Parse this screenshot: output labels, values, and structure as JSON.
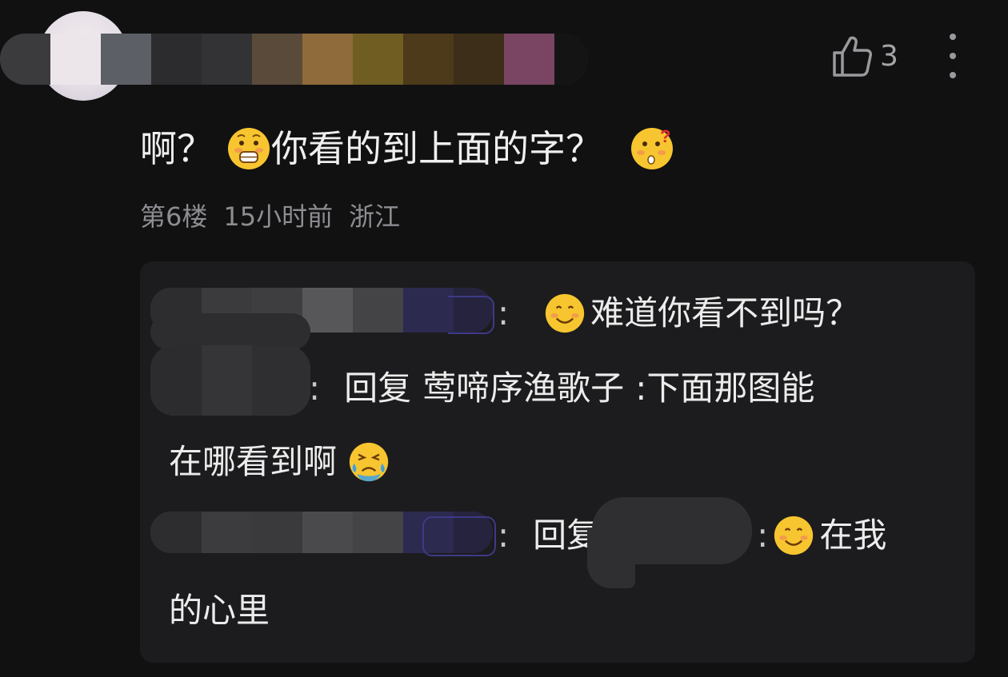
{
  "comment": {
    "like_count": "3",
    "text_part1": "啊？",
    "text_part2": "你看的到上面的字？",
    "meta": {
      "floor": "第6楼",
      "time": "15小时前",
      "location": "浙江"
    }
  },
  "replies": [
    {
      "colon": ":",
      "text": "难道你看不到吗？"
    },
    {
      "colon": ":",
      "reply_word": "回复",
      "target": "莺啼序渔歌子",
      "text_line1": ":下面那图能",
      "text_line2": "在哪看到啊"
    },
    {
      "colon": ":",
      "reply_word": "回复",
      "separator": ":",
      "text_line1": "在我",
      "text_line2": "的心里"
    }
  ],
  "icons": {
    "like": "thumbs-up-icon",
    "more": "more-vertical-icon",
    "emoji_scared": "scared-face-emoji-icon",
    "emoji_confused": "confused-face-emoji-icon",
    "emoji_smile": "smile-face-emoji-icon",
    "emoji_cry": "crying-face-emoji-icon"
  },
  "colors": {
    "background": "#111112",
    "panel": "#1c1c1e",
    "text": "#ececec",
    "meta_text": "#8d8d92",
    "handle_border": "#3d3a88"
  }
}
